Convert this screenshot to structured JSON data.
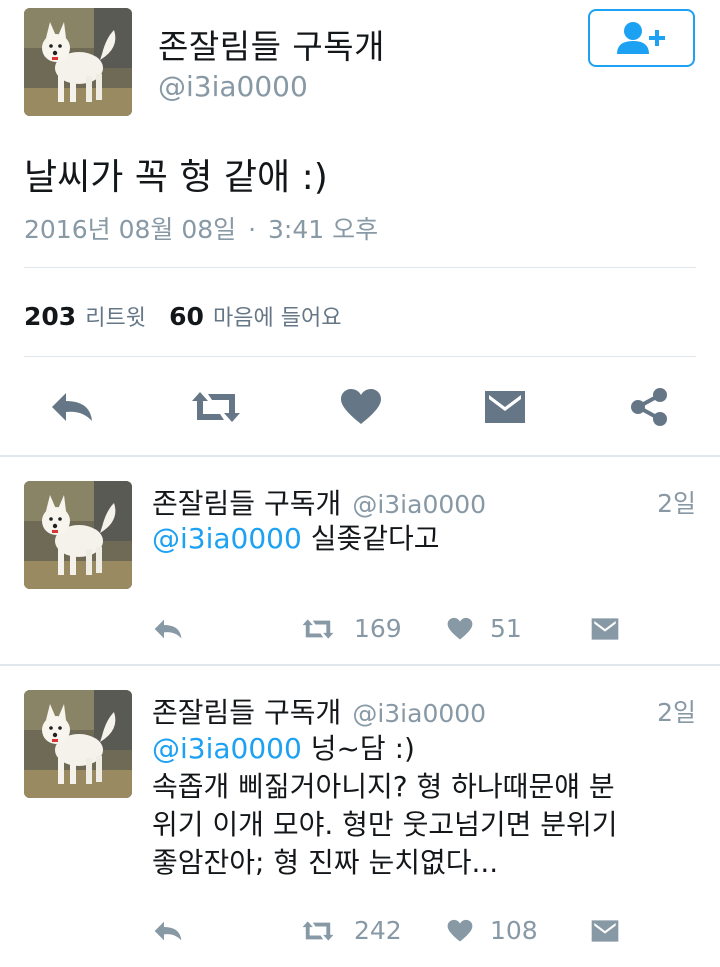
{
  "tweet": {
    "display_name": "존잘림들 구독개",
    "handle": "@i3ia0000",
    "text": "날씨가 꼭 형 같애 :)",
    "date": "2016년 08월 08일",
    "separator": "·",
    "time": "3:41 오후",
    "retweet_count": "203",
    "retweet_label": "리트윗",
    "like_count": "60",
    "like_label": "마음에 들어요"
  },
  "replies": [
    {
      "display_name": "존잘림들 구독개",
      "handle": "@i3ia0000",
      "time": "2일",
      "mention": "@i3ia0000",
      "text_after_mention": " 실좆같다고",
      "lines": [],
      "retweets": "169",
      "likes": "51"
    },
    {
      "display_name": "존잘림들 구독개",
      "handle": "@i3ia0000",
      "time": "2일",
      "mention": "@i3ia0000",
      "text_after_mention": " 넝~담 :)",
      "lines": [
        "속좁개 삐짊거아니지? 형 하나때문얘 분",
        "위기 이개 모야. 형만 웃고넘기면 분위기",
        "좋암잔아; 형 진짜 눈치엾다..."
      ],
      "retweets": "242",
      "likes": "108"
    }
  ],
  "colors": {
    "accent": "#1da1f2",
    "icon_gray": "#8899a6",
    "icon_dark": "#657786",
    "divider": "#e1e8ed"
  },
  "icons": {
    "follow": "add-user-icon",
    "reply": "reply-icon",
    "retweet": "retweet-icon",
    "like": "heart-icon",
    "dm": "envelope-icon",
    "share": "share-icon"
  }
}
